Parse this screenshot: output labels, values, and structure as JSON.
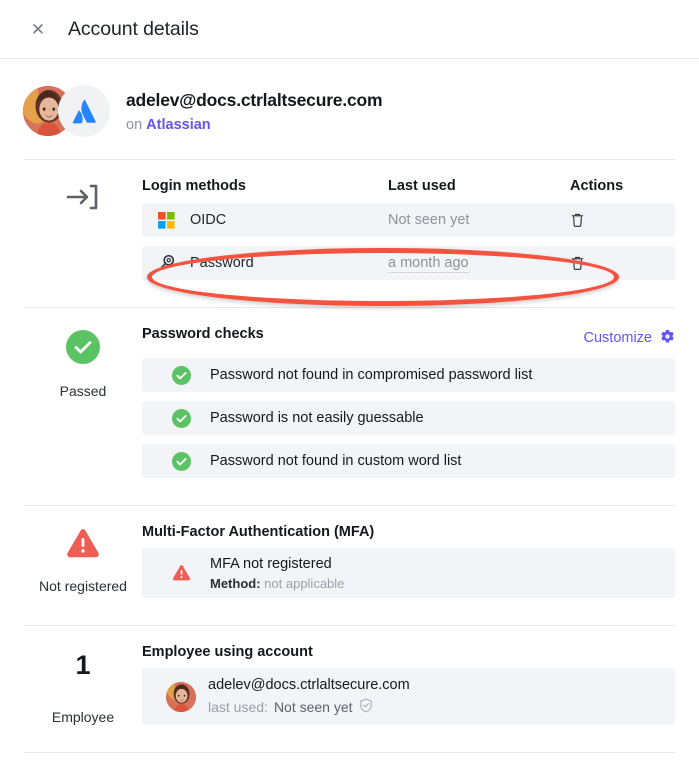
{
  "header": {
    "close_icon": "close-icon",
    "title": "Account details"
  },
  "identity": {
    "avatar_icon": "user-avatar",
    "app_icon": "atlassian-logo-icon",
    "email": "adelev@docs.ctrlaltsecure.com",
    "on_label": "on",
    "app_name": "Atlassian"
  },
  "login_methods": {
    "aside_icon": "login-arrow-icon",
    "columns": {
      "method": "Login methods",
      "last_used": "Last used",
      "actions": "Actions"
    },
    "rows": [
      {
        "icon": "microsoft-logo-icon",
        "name": "OIDC",
        "last_used": "Not seen yet",
        "last_used_underlined": false,
        "action_icon": "trash-icon"
      },
      {
        "icon": "key-icon",
        "name": "Password",
        "last_used": "a month ago",
        "last_used_underlined": true,
        "action_icon": "trash-icon"
      }
    ]
  },
  "password_checks": {
    "aside_icon": "check-circle-icon",
    "aside_label": "Passed",
    "title": "Password checks",
    "customize_label": "Customize",
    "customize_icon": "gear-icon",
    "items": [
      {
        "icon": "check-circle-icon",
        "label": "Password not found in compromised password list"
      },
      {
        "icon": "check-circle-icon",
        "label": "Password is not easily guessable"
      },
      {
        "icon": "check-circle-icon",
        "label": "Password not found in custom word list"
      }
    ]
  },
  "mfa": {
    "aside_icon": "warning-triangle-icon",
    "aside_label": "Not registered",
    "title": "Multi-Factor Authentication (MFA)",
    "row": {
      "icon": "warning-triangle-icon",
      "title": "MFA not registered",
      "method_label": "Method:",
      "method_value": "not applicable"
    }
  },
  "employee": {
    "count": "1",
    "aside_label": "Employee",
    "title": "Employee using account",
    "row": {
      "avatar_icon": "user-avatar",
      "email": "adelev@docs.ctrlaltsecure.com",
      "last_used_label": "last used:",
      "last_used_value": "Not seen yet",
      "shield_icon": "shield-check-icon"
    }
  },
  "annotation": {
    "shape": "ellipse-highlight",
    "color": "#f4533f",
    "target": "password-login-method-row"
  },
  "colors": {
    "accent_purple": "#6554f0",
    "success_green": "#5cc364",
    "warning_red": "#ef5d54",
    "row_background": "#f3f4f8",
    "annotation_red": "#f4533f"
  }
}
